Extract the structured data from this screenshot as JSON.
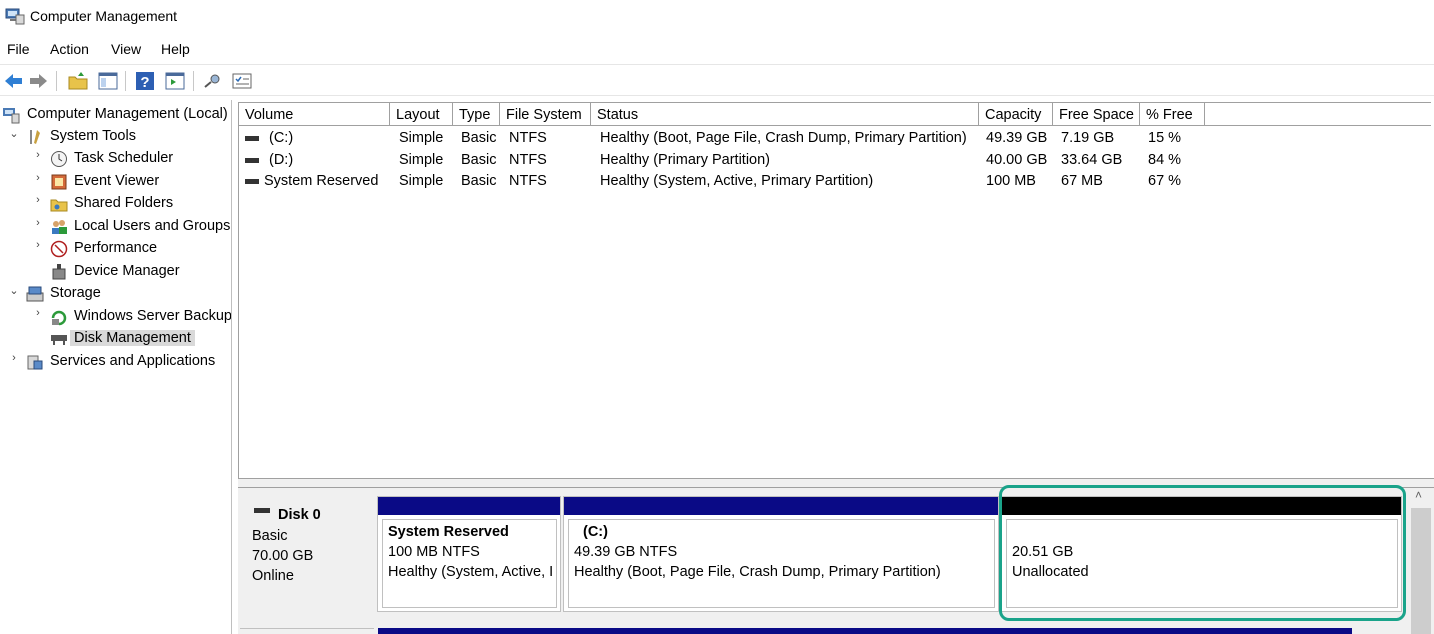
{
  "window": {
    "title": "Computer Management"
  },
  "menu": [
    "File",
    "Action",
    "View",
    "Help"
  ],
  "toolbar": {
    "buttons": [
      "back-icon",
      "forward-icon",
      "up-folder-icon",
      "show-hide-tree-icon",
      "help-icon",
      "action-pane-icon",
      "connect-icon",
      "properties-icon"
    ]
  },
  "tree": {
    "root": "Computer Management (Local)",
    "system_tools": "System Tools",
    "task_scheduler": "Task Scheduler",
    "event_viewer": "Event Viewer",
    "shared_folders": "Shared Folders",
    "local_users": "Local Users and Groups",
    "performance": "Performance",
    "device_manager": "Device Manager",
    "storage": "Storage",
    "wsb": "Windows Server Backup",
    "disk_mgmt": "Disk Management",
    "services": "Services and Applications"
  },
  "columns": [
    "Volume",
    "Layout",
    "Type",
    "File System",
    "Status",
    "Capacity",
    "Free Space",
    "% Free"
  ],
  "volumes": [
    {
      "volume": "(C:)",
      "layout": "Simple",
      "type": "Basic",
      "fs": "NTFS",
      "status": "Healthy (Boot, Page File, Crash Dump, Primary Partition)",
      "capacity": "49.39 GB",
      "free": "7.19 GB",
      "pct": "15 %"
    },
    {
      "volume": "(D:)",
      "layout": "Simple",
      "type": "Basic",
      "fs": "NTFS",
      "status": "Healthy (Primary Partition)",
      "capacity": "40.00 GB",
      "free": "33.64 GB",
      "pct": "84 %"
    },
    {
      "volume": "System Reserved",
      "layout": "Simple",
      "type": "Basic",
      "fs": "NTFS",
      "status": "Healthy (System, Active, Primary Partition)",
      "capacity": "100 MB",
      "free": "67 MB",
      "pct": "67 %"
    }
  ],
  "disk0": {
    "name": "Disk 0",
    "type": "Basic",
    "size": "70.00 GB",
    "state": "Online",
    "partitions": [
      {
        "name": "System Reserved",
        "size_fs": "100 MB NTFS",
        "status": "Healthy (System, Active, I"
      },
      {
        "name": "(C:)",
        "size_fs": "49.39 GB NTFS",
        "status": "Healthy (Boot, Page File, Crash Dump, Primary Partition)"
      },
      {
        "name": "",
        "size_fs": "20.51 GB",
        "status": "Unallocated"
      }
    ]
  },
  "colors": {
    "primary_partition": "#0a0a86",
    "unallocated": "#000000",
    "highlight": "#1aa38a"
  }
}
